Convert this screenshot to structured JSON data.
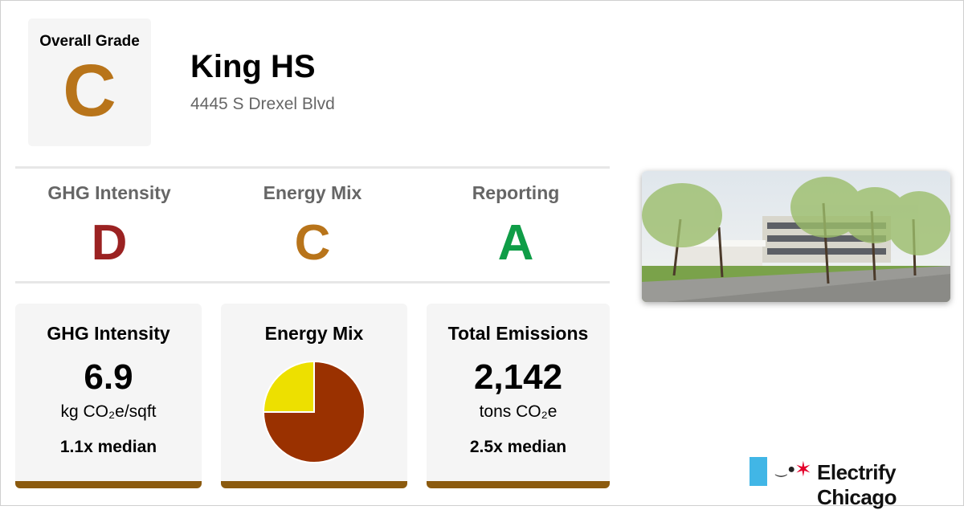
{
  "building": {
    "name": "King HS",
    "address": "4445 S Drexel Blvd"
  },
  "overall": {
    "label": "Overall Grade",
    "grade": "C",
    "color": "#b8741a"
  },
  "subgrades": [
    {
      "label": "GHG Intensity",
      "grade": "D",
      "color": "#9b2222"
    },
    {
      "label": "Energy Mix",
      "grade": "C",
      "color": "#b8741a"
    },
    {
      "label": "Reporting",
      "grade": "A",
      "color": "#0f9d47"
    }
  ],
  "cards": {
    "ghg": {
      "title": "GHG Intensity",
      "value": "6.9",
      "unit": "kg CO₂e/sqft",
      "median": "1.1x median"
    },
    "mix": {
      "title": "Energy Mix"
    },
    "emissions": {
      "title": "Total Emissions",
      "value": "2,142",
      "unit": "tons CO₂e",
      "median": "2.5x median"
    }
  },
  "chart_data": {
    "type": "pie",
    "series": [
      {
        "value": 75,
        "color": "#9a3100"
      },
      {
        "value": 25,
        "color": "#ede000"
      }
    ]
  },
  "photo": {
    "icon": "building-street-photo"
  },
  "brand": {
    "name": "Electrify Chicago",
    "icon_plug": "plug-icon",
    "icon_star": "chicago-star-icon"
  },
  "colors": {
    "card_bar": "#8b5a0e",
    "card_bg": "#f5f5f5",
    "divider": "#e7e7e7"
  }
}
